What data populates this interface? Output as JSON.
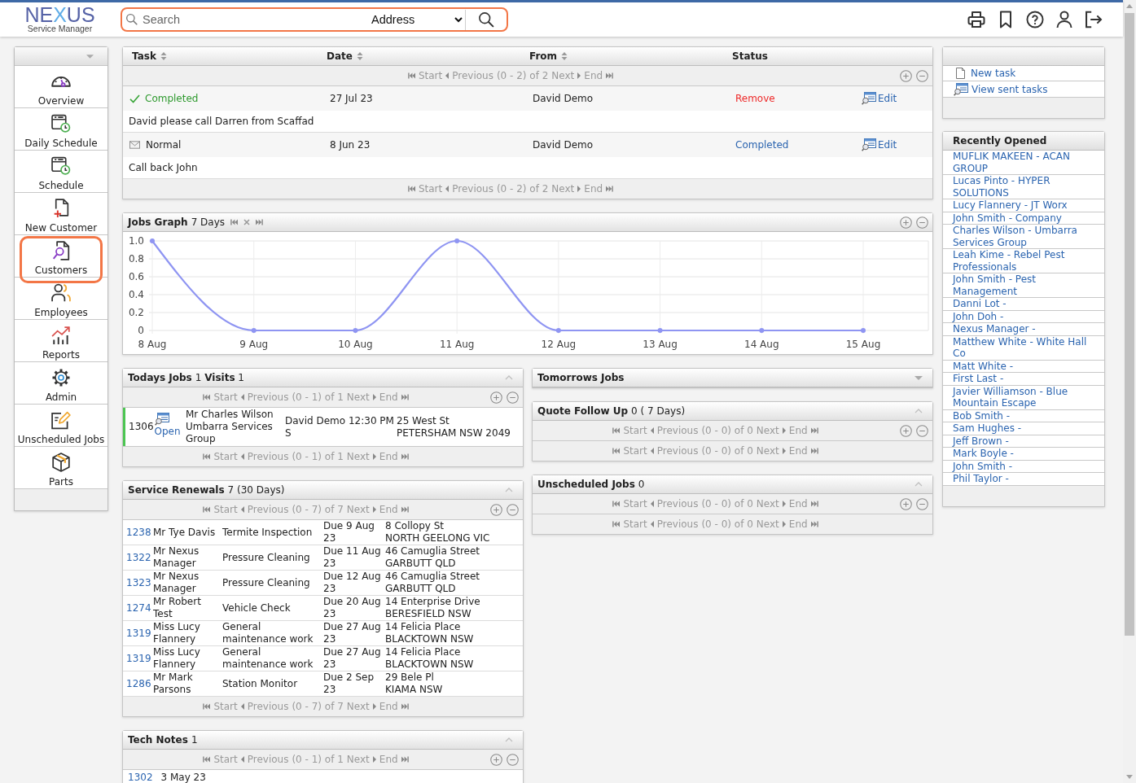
{
  "header": {
    "logo": {
      "wordmark": [
        {
          "text": "NE",
          "accent": false
        },
        {
          "text": "X",
          "accent": true
        },
        {
          "text": "US",
          "accent": false
        }
      ],
      "tagline": "Service Manager"
    },
    "search": {
      "placeholder": "Search",
      "scope": "Address",
      "highlighted": true
    }
  },
  "sidebar": {
    "items": [
      {
        "label": "Overview",
        "highlighted": false
      },
      {
        "label": "Daily Schedule",
        "highlighted": false
      },
      {
        "label": "Schedule",
        "highlighted": false
      },
      {
        "label": "New Customer",
        "highlighted": false
      },
      {
        "label": "Customers",
        "highlighted": true
      },
      {
        "label": "Employees",
        "highlighted": false
      },
      {
        "label": "Reports",
        "highlighted": false
      },
      {
        "label": "Admin",
        "highlighted": false
      },
      {
        "label": "Unscheduled Jobs",
        "highlighted": false
      },
      {
        "label": "Parts",
        "highlighted": false
      }
    ]
  },
  "tasks": {
    "columns": [
      {
        "label": "Task",
        "sortable": true
      },
      {
        "label": "Date",
        "sortable": true
      },
      {
        "label": "From",
        "sortable": true
      },
      {
        "label": "Status",
        "sortable": false
      }
    ],
    "pagers": [
      {
        "start": "Start",
        "previous": "Previous",
        "range": "(0 - 2) of 2",
        "next": "Next",
        "end": "End"
      },
      {
        "start": "Start",
        "previous": "Previous",
        "range": "(0 - 2) of 2",
        "next": "Next",
        "end": "End"
      }
    ],
    "rows": [
      {
        "kind": "completed",
        "priority": "Completed",
        "date": "27 Jul 23",
        "from": "David Demo",
        "action": "Remove",
        "edit": "Edit",
        "message": "David please call Darren from Scaffad"
      },
      {
        "kind": "normal",
        "priority": "Normal",
        "date": "8 Jun 23",
        "from": "David Demo",
        "action": "Completed",
        "edit": "Edit",
        "message": "Call back John"
      }
    ]
  },
  "jobs_graph": {
    "title": "Jobs Graph",
    "note": "7 Days",
    "chart_data": {
      "type": "line",
      "grid": true,
      "categories": [
        "8 Aug",
        "9 Aug",
        "10 Aug",
        "11 Aug",
        "12 Aug",
        "13 Aug",
        "14 Aug",
        "15 Aug"
      ],
      "series": [
        {
          "color": "#8f95f2",
          "marker": "circle",
          "values": [
            1,
            0,
            0,
            1,
            0,
            0,
            0,
            0
          ]
        }
      ],
      "ylim": [
        0,
        1
      ],
      "yticks": [
        0,
        0.2,
        0.4,
        0.6,
        0.8,
        {
          "value": 1,
          "label": "1.0"
        }
      ]
    }
  },
  "todays_jobs": {
    "title": "Todays Jobs",
    "note": "1 **Visits** 1",
    "expanded": true,
    "pagers": [
      {
        "start": "Start",
        "previous": "Previous",
        "range": "(0 - 1) of 1",
        "next": "Next",
        "end": "End"
      },
      {
        "start": "Start",
        "previous": "Previous",
        "range": "(0 - 1) of 1",
        "next": "Next",
        "end": "End"
      }
    ],
    "rows": [
      {
        "job_no": "1306",
        "status": "Open",
        "color": "#4cc552",
        "contact": "Mr Charles Wilson",
        "company": "Umbarra Services Group",
        "assigned": "David Demo 12:30 PM S",
        "street": "25 West St",
        "locality": "PETERSHAM NSW 2049"
      }
    ]
  },
  "service_renewals": {
    "title": "Service Renewals",
    "note": "7 (30 Days)",
    "expanded": true,
    "pagers": [
      {
        "start": "Start",
        "previous": "Previous",
        "range": "(0 - 7) of 7",
        "next": "Next",
        "end": "End"
      },
      {
        "start": "Start",
        "previous": "Previous",
        "range": "(0 - 7) of 7",
        "next": "Next",
        "end": "End"
      }
    ],
    "rows": [
      {
        "job_no": "1238",
        "customer": "Mr Tye Davis",
        "service": "Termite Inspection",
        "due": "Due 9 Aug 23",
        "street": "8 Collopy St",
        "locality": "NORTH GEELONG VIC"
      },
      {
        "job_no": "1322",
        "customer": "Mr Nexus Manager",
        "service": "Pressure Cleaning",
        "due": "Due 11 Aug 23",
        "street": "46 Camuglia Street",
        "locality": "GARBUTT QLD"
      },
      {
        "job_no": "1323",
        "customer": "Mr Nexus Manager",
        "service": "Pressure Cleaning",
        "due": "Due 12 Aug 23",
        "street": "46 Camuglia Street",
        "locality": "GARBUTT QLD"
      },
      {
        "job_no": "1274",
        "customer": "Mr Robert Test",
        "service": "Vehicle Check",
        "due": "Due 20 Aug 23",
        "street": "14 Enterprise Drive",
        "locality": "BERESFIELD NSW"
      },
      {
        "job_no": "1319",
        "customer": "Miss Lucy Flannery",
        "service": "General maintenance work",
        "due": "Due 27 Aug 23",
        "street": "14 Felicia Place",
        "locality": "BLACKTOWN NSW"
      },
      {
        "job_no": "1319",
        "customer": "Miss Lucy Flannery",
        "service": "General maintenance work",
        "due": "Due 27 Aug 23",
        "street": "14 Felicia Place",
        "locality": "BLACKTOWN NSW"
      },
      {
        "job_no": "1286",
        "customer": "Mr Mark Parsons",
        "service": "Station Monitor",
        "due": "Due 2 Sep 23",
        "street": "29 Bele Pl",
        "locality": "KIAMA NSW"
      }
    ]
  },
  "tech_notes": {
    "title": "Tech Notes",
    "note": "1",
    "expanded": true,
    "pagers": [
      {
        "start": "Start",
        "previous": "Previous",
        "range": "(0 - 1) of 1",
        "next": "Next",
        "end": "End"
      }
    ],
    "rows": [
      {
        "job_no": "1302",
        "date": "3 May 23"
      }
    ]
  },
  "tomorrows_jobs": {
    "title": "Tomorrows Jobs",
    "expanded": false
  },
  "quote_follow_up": {
    "title": "Quote Follow Up",
    "note": "0 ( 7 Days)",
    "expanded": true,
    "pagers": [
      {
        "start": "Start",
        "previous": "Previous",
        "range": "(0 - 0) of 0",
        "next": "Next",
        "end": "End"
      },
      {
        "start": "Start",
        "previous": "Previous",
        "range": "(0 - 0) of 0",
        "next": "Next",
        "end": "End"
      }
    ]
  },
  "unscheduled_jobs": {
    "title": "Unscheduled Jobs",
    "note": "0",
    "expanded": true,
    "pagers": [
      {
        "start": "Start",
        "previous": "Previous",
        "range": "(0 - 0) of 0",
        "next": "Next",
        "end": "End"
      },
      {
        "start": "Start",
        "previous": "Previous",
        "range": "(0 - 0) of 0",
        "next": "Next",
        "end": "End"
      }
    ]
  },
  "actions": {
    "items": [
      {
        "label": "New task"
      },
      {
        "label": "View sent tasks"
      }
    ]
  },
  "recently_opened": {
    "title": "Recently Opened",
    "items": [
      "MUFLIK MAKEEN - ACAN GROUP",
      "Lucas Pinto - HYPER SOLUTIONS",
      "Lucy Flannery - JT Worx",
      "John Smith - Company",
      "Charles Wilson - Umbarra Services Group",
      "Leah Kime - Rebel Pest Professionals",
      "John Smith - Pest Management",
      "Danni Lot -",
      "John Doh -",
      "Nexus Manager -",
      "Matthew White - White Hall Co",
      "Matt White -",
      "First Last -",
      "Javier Williamson - Blue Mountain Escape",
      "Bob Smith -",
      "Sam Hughes -",
      "Jeff Brown -",
      "Mark Boyle -",
      "John Smith -",
      "Phil Taylor -"
    ]
  }
}
